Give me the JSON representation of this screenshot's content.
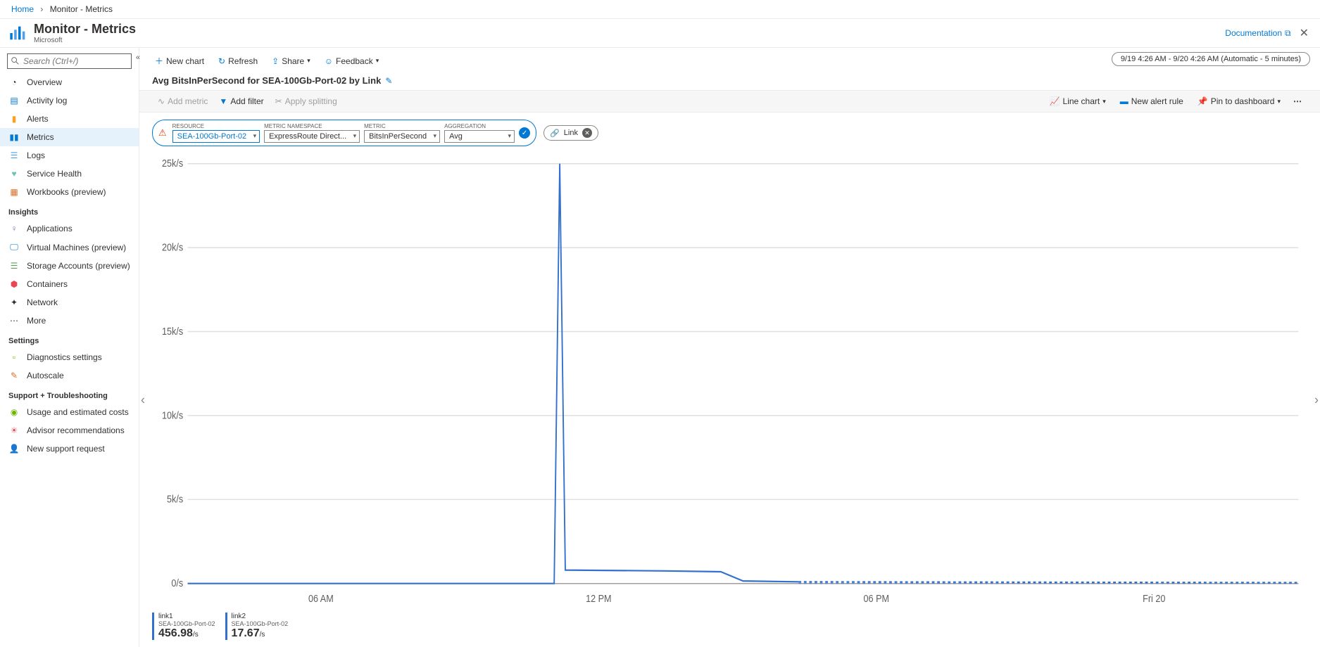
{
  "breadcrumb": {
    "home": "Home",
    "current": "Monitor - Metrics"
  },
  "header": {
    "title": "Monitor - Metrics",
    "subtitle": "Microsoft",
    "documentation": "Documentation"
  },
  "sidebar": {
    "search_placeholder": "Search (Ctrl+/)",
    "items": [
      {
        "label": "Overview"
      },
      {
        "label": "Activity log"
      },
      {
        "label": "Alerts"
      },
      {
        "label": "Metrics"
      },
      {
        "label": "Logs"
      },
      {
        "label": "Service Health"
      },
      {
        "label": "Workbooks (preview)"
      }
    ],
    "section_insights": "Insights",
    "insights_items": [
      {
        "label": "Applications"
      },
      {
        "label": "Virtual Machines (preview)"
      },
      {
        "label": "Storage Accounts (preview)"
      },
      {
        "label": "Containers"
      },
      {
        "label": "Network"
      },
      {
        "label": "More"
      }
    ],
    "section_settings": "Settings",
    "settings_items": [
      {
        "label": "Diagnostics settings"
      },
      {
        "label": "Autoscale"
      }
    ],
    "section_support": "Support + Troubleshooting",
    "support_items": [
      {
        "label": "Usage and estimated costs"
      },
      {
        "label": "Advisor recommendations"
      },
      {
        "label": "New support request"
      }
    ]
  },
  "toolbar": {
    "new_chart": "New chart",
    "refresh": "Refresh",
    "share": "Share",
    "feedback": "Feedback",
    "time_range": "9/19 4:26 AM - 9/20 4:26 AM (Automatic - 5 minutes)"
  },
  "chart": {
    "title": "Avg BitsInPerSecond for SEA-100Gb-Port-02 by Link"
  },
  "toolbar2": {
    "add_metric": "Add metric",
    "add_filter": "Add filter",
    "apply_splitting": "Apply splitting",
    "line_chart": "Line chart",
    "new_alert_rule": "New alert rule",
    "pin_to_dashboard": "Pin to dashboard"
  },
  "selector": {
    "resource_label": "RESOURCE",
    "resource_value": "SEA-100Gb-Port-02",
    "namespace_label": "METRIC NAMESPACE",
    "namespace_value": "ExpressRoute Direct...",
    "metric_label": "METRIC",
    "metric_value": "BitsInPerSecond",
    "agg_label": "AGGREGATION",
    "agg_value": "Avg",
    "link_pill": "Link"
  },
  "legend": [
    {
      "name": "link1",
      "sub": "SEA-100Gb-Port-02",
      "value": "456.98",
      "unit": "/s"
    },
    {
      "name": "link2",
      "sub": "SEA-100Gb-Port-02",
      "value": "17.67",
      "unit": "/s"
    }
  ],
  "chart_data": {
    "type": "line",
    "title": "Avg BitsInPerSecond for SEA-100Gb-Port-02 by Link",
    "ylabel": "",
    "y_ticks": [
      "0/s",
      "5k/s",
      "10k/s",
      "15k/s",
      "20k/s",
      "25k/s"
    ],
    "x_ticks": [
      "06 AM",
      "12 PM",
      "06 PM",
      "Fri 20"
    ],
    "ylim": [
      0,
      25000
    ],
    "series": [
      {
        "name": "link1",
        "color": "#3370cc",
        "points_desc": "near zero from start until just before 12 PM, single sharp spike to ~25000, drops to ~800 plateau until ~3 PM, then near zero; dashed projection continues near zero after ~4 PM"
      },
      {
        "name": "link2",
        "color": "#3370cc",
        "points_desc": "near zero throughout; dashed projection near zero after ~4 PM"
      }
    ]
  }
}
